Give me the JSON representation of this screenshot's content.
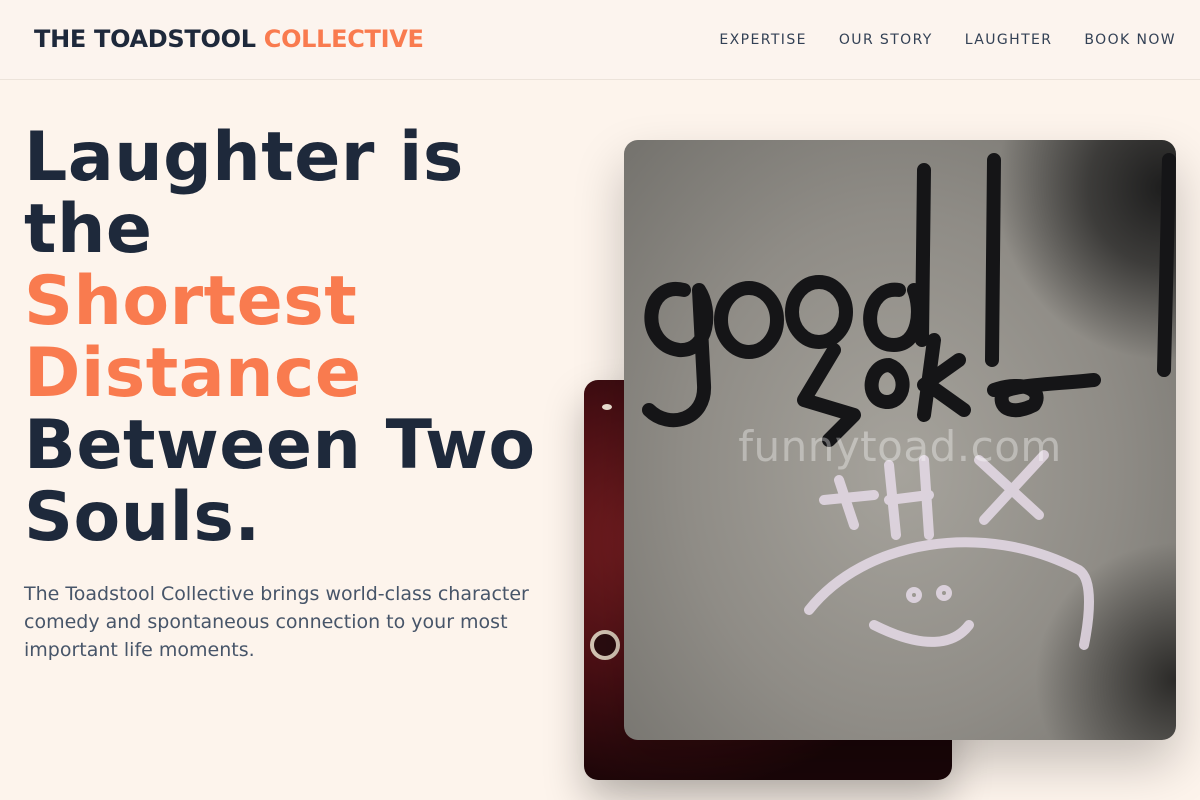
{
  "header": {
    "brand_main": "THE TOADSTOOL",
    "brand_accent": "COLLECTIVE",
    "nav": [
      "EXPERTISE",
      "OUR STORY",
      "LAUGHTER",
      "BOOK NOW"
    ]
  },
  "hero": {
    "title_line1": "Laughter is",
    "title_line2": "the",
    "title_highlight1": "Shortest",
    "title_highlight2": "Distance",
    "title_line3": "Between Two",
    "title_line4": "Souls.",
    "subtitle": "The Toadstool Collective brings world-class character comedy and spontaneous connection to your most important life moments."
  },
  "gallery": {
    "watermark": "funnytoad.com"
  },
  "colors": {
    "accent": "#f97b4f",
    "heading": "#1e293b",
    "background": "#fdf4ec"
  }
}
